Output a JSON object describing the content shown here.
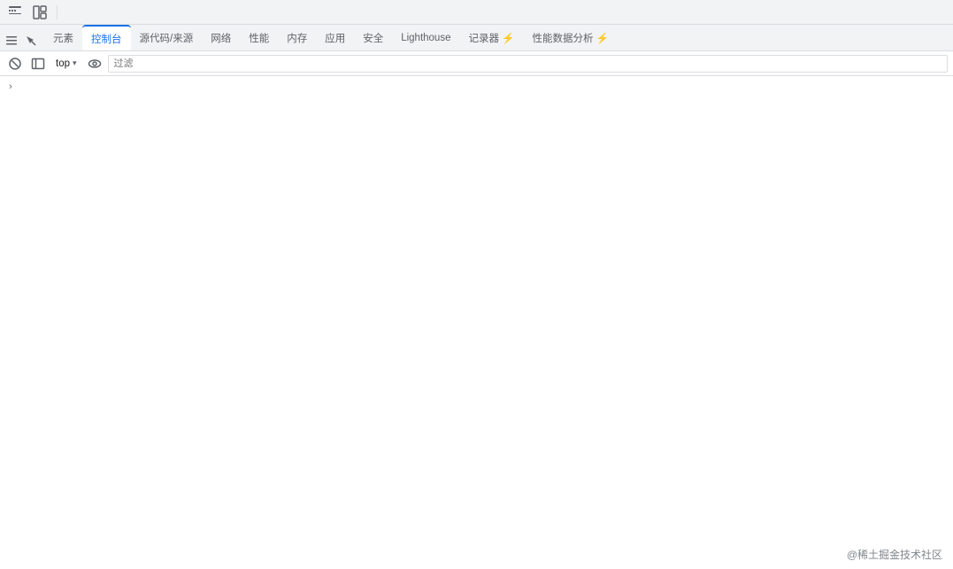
{
  "topToolbar": {
    "icon1": "☰",
    "icon2": "⬜"
  },
  "tabs": [
    {
      "id": "elements",
      "label": "元素",
      "active": false
    },
    {
      "id": "console",
      "label": "控制台",
      "active": true
    },
    {
      "id": "sources",
      "label": "源代码/来源",
      "active": false
    },
    {
      "id": "network",
      "label": "网络",
      "active": false
    },
    {
      "id": "performance",
      "label": "性能",
      "active": false
    },
    {
      "id": "memory",
      "label": "内存",
      "active": false
    },
    {
      "id": "application",
      "label": "应用",
      "active": false
    },
    {
      "id": "security",
      "label": "安全",
      "active": false
    },
    {
      "id": "lighthouse",
      "label": "Lighthouse",
      "active": false
    },
    {
      "id": "recorder",
      "label": "记录器 ⚡",
      "active": false
    },
    {
      "id": "performance-insights",
      "label": "性能数据分析 ⚡",
      "active": false
    }
  ],
  "consoleToolbar": {
    "clearIcon": "🚫",
    "sidebarIcon": "⬜",
    "contextLabel": "top",
    "contextArrow": "▼",
    "eyeIcon": "👁",
    "filterPlaceholder": "过滤"
  },
  "content": {
    "chevron": "›"
  },
  "watermark": "@稀土掘金技术社区"
}
